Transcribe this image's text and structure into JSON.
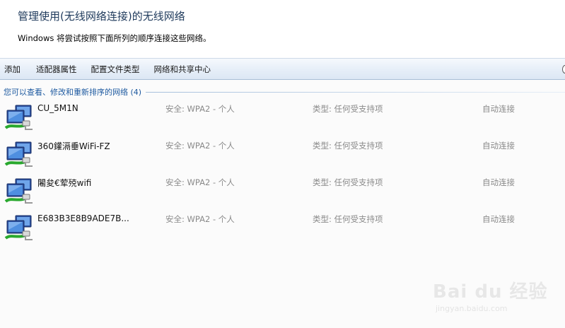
{
  "header": {
    "title": "管理使用(无线网络连接)的无线网络",
    "subtitle": "Windows 将尝试按照下面所列的顺序连接这些网络。"
  },
  "toolbar": {
    "add_label": "添加",
    "adapter_label": "适配器属性",
    "profile_label": "配置文件类型",
    "sharing_label": "网络和共享中心"
  },
  "group": {
    "label": "您可以查看、修改和重新排序的网络 (4)"
  },
  "networks": [
    {
      "name": "CU_5M1N",
      "security": "安全: WPA2 - 个人",
      "type": "类型: 任何受支持项",
      "mode": "自动连接"
    },
    {
      "name": "360鑵滆垂WiFi-FZ",
      "security": "安全: WPA2 - 个人",
      "type": "类型: 任何受支持项",
      "mode": "自动连接"
    },
    {
      "name": "闂夋€荤殑wifi",
      "security": "安全: WPA2 - 个人",
      "type": "类型: 任何受支持项",
      "mode": "自动连接"
    },
    {
      "name": "E683B3E8B9ADE7B...",
      "security": "安全: WPA2 - 个人",
      "type": "类型: 任何受支持项",
      "mode": "自动连接"
    }
  ],
  "icons": {
    "network": "wireless-network-icon"
  },
  "colors": {
    "title": "#1e395b",
    "group_label": "#1e5aa0",
    "meta_text": "#8a8a8a",
    "toolbar_top": "#f5f9fd",
    "toolbar_bottom": "#dce7f4"
  },
  "watermark": {
    "text": "Bai du 经验",
    "url": "jingyan.baidu.com"
  }
}
